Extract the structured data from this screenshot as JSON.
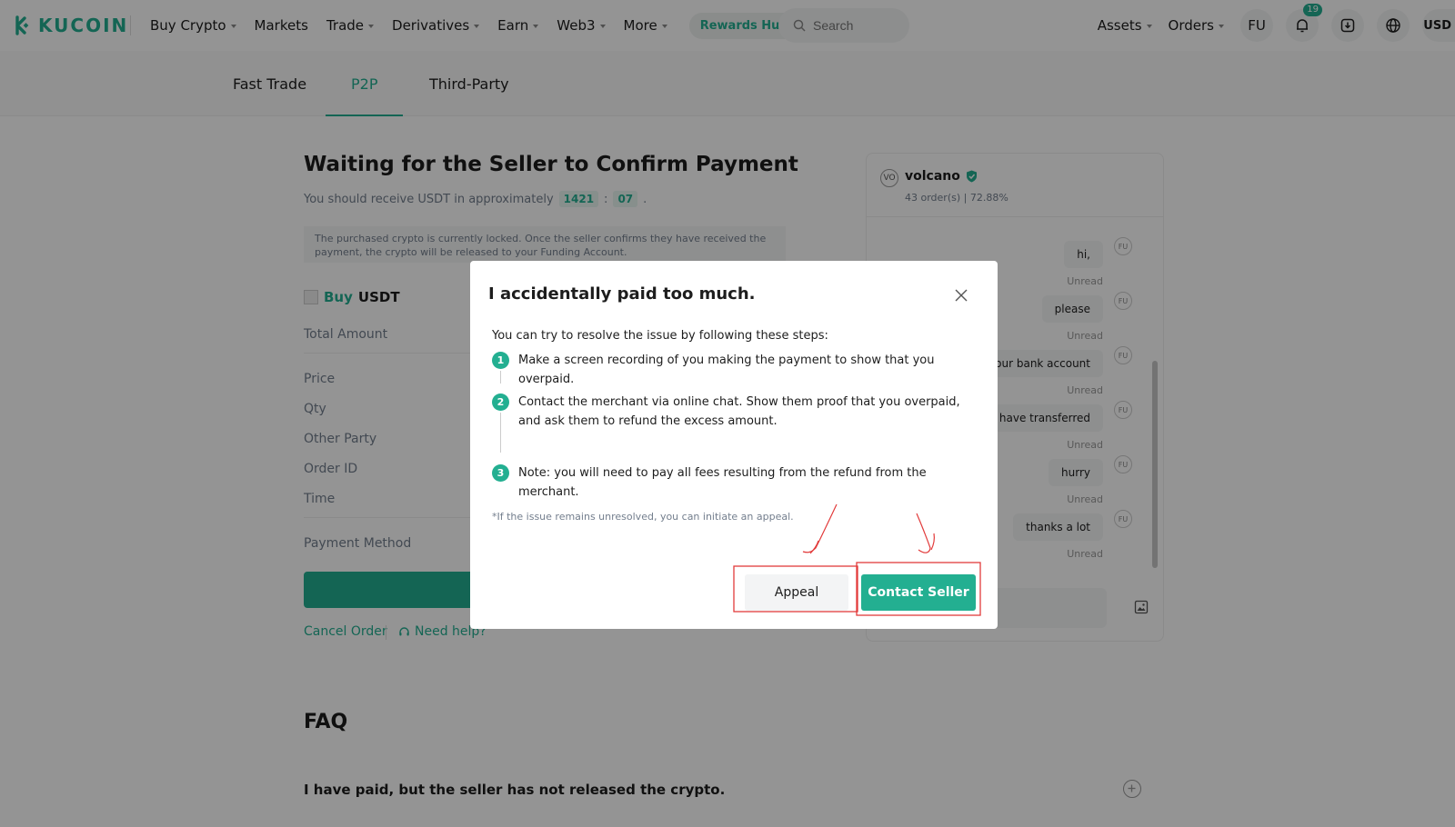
{
  "brand": {
    "logo_text": "KUCOIN",
    "accent_color": "#23af91"
  },
  "nav": {
    "items": [
      {
        "label": "Buy Crypto",
        "has_caret": true
      },
      {
        "label": "Markets",
        "has_caret": false
      },
      {
        "label": "Trade",
        "has_caret": true
      },
      {
        "label": "Derivatives",
        "has_caret": true
      },
      {
        "label": "Earn",
        "has_caret": true
      },
      {
        "label": "Web3",
        "has_caret": true
      },
      {
        "label": "More",
        "has_caret": true
      }
    ],
    "rewards_label": "Rewards Hub",
    "search_placeholder": "Search",
    "assets_label": "Assets",
    "orders_label": "Orders",
    "user_initials": "FU",
    "notification_count": "19",
    "currency": "USD"
  },
  "tabs": [
    {
      "label": "Fast Trade",
      "active": false
    },
    {
      "label": "P2P",
      "active": true
    },
    {
      "label": "Third-Party",
      "active": false
    }
  ],
  "order": {
    "title": "Waiting for the Seller to Confirm Payment",
    "receive_prefix": "You should receive USDT in approximately",
    "minutes": "1421",
    "colon": ":",
    "seconds": "07",
    "period": ".",
    "notice": "The purchased crypto is currently locked. Once the seller confirms they have received the payment, the crypto will be released to your Funding Account.",
    "buy_word": "Buy",
    "coin": "USDT",
    "fields": {
      "total_amount": "Total Amount",
      "price": "Price",
      "qty": "Qty",
      "other_party": "Other Party",
      "order_id": "Order ID",
      "time": "Time",
      "payment_method": "Payment Method"
    },
    "cancel_label": "Cancel Order",
    "help_label": "Need help?"
  },
  "faq": {
    "title": "FAQ",
    "question_1": "I have paid, but the seller has not released the crypto."
  },
  "chat": {
    "partner_initials": "VO",
    "partner_name": "volcano",
    "stats": "43 order(s) | 72.88%",
    "user_initials": "FU",
    "unread_label": "Unread",
    "messages": [
      "hi,",
      "please",
      "k your bank account",
      "i have transferred",
      "hurry",
      "thanks a lot"
    ]
  },
  "modal": {
    "title": "I accidentally paid too much.",
    "intro": "You can try to resolve the issue by following these steps:",
    "steps": [
      {
        "num": "1",
        "text": "Make a screen recording of you making the payment to show that you overpaid."
      },
      {
        "num": "2",
        "text": "Contact the merchant via online chat. Show them proof that you overpaid, and ask them to refund the excess amount."
      },
      {
        "num": "3",
        "text": "Note: you will need to pay all fees resulting from the refund from the merchant."
      }
    ],
    "note": "*If the issue remains unresolved, you can initiate an appeal.",
    "appeal_label": "Appeal",
    "contact_label": "Contact Seller"
  }
}
